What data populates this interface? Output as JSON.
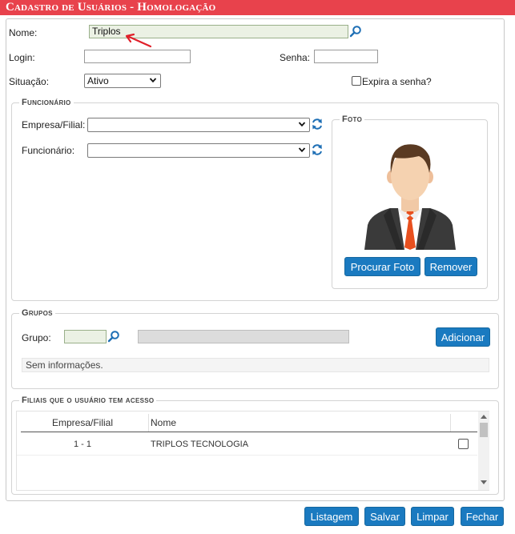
{
  "window": {
    "title": "Cadastro de Usuários  - Homologação"
  },
  "form": {
    "nome_label": "Nome:",
    "nome_value": "Triplos",
    "login_label": "Login:",
    "login_value": "",
    "senha_label": "Senha:",
    "senha_value": "",
    "situacao_label": "Situação:",
    "situacao_value": "Ativo",
    "expira_label": "Expira a senha?",
    "expira_checked": false
  },
  "funcionario": {
    "legend": "Funcionário",
    "empresa_label": "Empresa/Filial:",
    "empresa_value": "",
    "funcionario_label": "Funcionário:",
    "funcionario_value": ""
  },
  "foto": {
    "legend": "Foto",
    "procurar_label": "Procurar Foto",
    "remover_label": "Remover"
  },
  "grupos": {
    "legend": "Grupos",
    "grupo_label": "Grupo:",
    "grupo_code": "",
    "grupo_name": "",
    "adicionar_label": "Adicionar",
    "empty_text": "Sem informações."
  },
  "filiais": {
    "legend": "Filiais que o usuário tem acesso",
    "columns": [
      "Empresa/Filial",
      "Nome"
    ],
    "rows": [
      {
        "empresa_filial": "1 - 1",
        "nome": "TRIPLOS TECNOLOGIA",
        "checked": false
      }
    ]
  },
  "footer": {
    "listagem_label": "Listagem",
    "salvar_label": "Salvar",
    "limpar_label": "Limpar",
    "fechar_label": "Fechar"
  },
  "colors": {
    "title_bg": "#e8424c",
    "button_bg": "#1a7ac0",
    "annotation_arrow": "#e0202a",
    "tie": "#e8501f",
    "suit": "#3a3a3a"
  },
  "icons": {
    "search": "search-icon",
    "refresh": "refresh-icon",
    "dropdown": "chevron-down-icon"
  }
}
